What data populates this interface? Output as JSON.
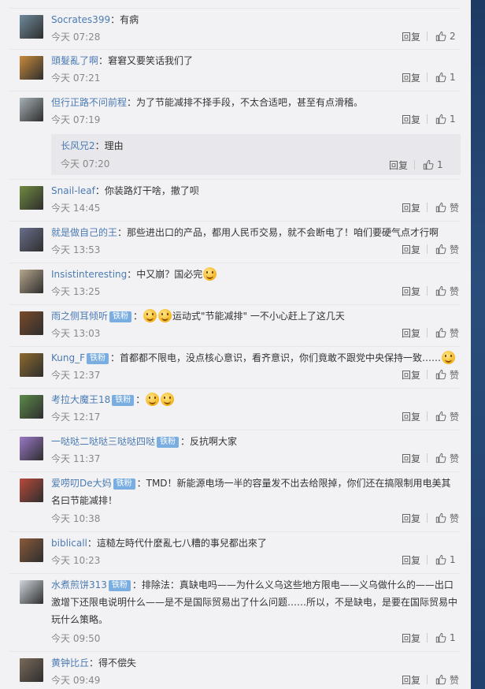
{
  "comments": [
    {
      "user": "Socrates399",
      "badge": "",
      "text": "：有病",
      "time": "今天 07:28",
      "reply": "回复",
      "likes": "2",
      "avatar": "#6e8a9b"
    },
    {
      "user": "頭髮亂了啊",
      "badge": "",
      "text": "：窘窘又要笑话我们了",
      "time": "今天 07:21",
      "reply": "回复",
      "likes": "1",
      "avatar": "#c98a3a"
    },
    {
      "user": "但行正路不问前程",
      "badge": "",
      "text": "：为了节能减排不择手段，不太合适吧，甚至有点滑稽。",
      "time": "今天 07:19",
      "reply": "回复",
      "likes": "1",
      "avatar": "#a7b1b6",
      "sub": {
        "user": "长风兄2",
        "text": "：理由",
        "time": "今天 07:20",
        "reply": "回复",
        "likes": "1"
      }
    },
    {
      "user": "Snail-leaf",
      "badge": "",
      "text": "：你装路灯干啥，撤了呗",
      "time": "今天 14:45",
      "reply": "回复",
      "likes": "赞",
      "avatar": "#6f8a3e"
    },
    {
      "user": "就是做自己的王",
      "badge": "",
      "text": "：那些进出口的产品，都用人民币交易，就不会断电了！咱们要硬气点才行啊",
      "time": "今天 13:53",
      "reply": "回复",
      "likes": "赞",
      "avatar": "#6a6f8c"
    },
    {
      "user": "Insistinteresting",
      "badge": "",
      "text": "：中又崩？国必完",
      "emoji": 1,
      "time": "今天 13:25",
      "reply": "回复",
      "likes": "赞",
      "avatar": "#b7a68c"
    },
    {
      "user": "雨之侧耳倾听",
      "badge": "铁粉",
      "text": "：运动式\"节能减排\"     一不小心赶上了这几天",
      "emojiBefore": 2,
      "time": "今天 13:03",
      "reply": "回复",
      "likes": "赞",
      "avatar": "#7a4a2a"
    },
    {
      "user": "Kung_F",
      "badge": "铁粉",
      "text": "：首都都不限电，没点核心意识，看齐意识，你们竟敢不跟党中央保持一致……",
      "emoji": 1,
      "time": "今天 12:37",
      "reply": "回复",
      "likes": "赞",
      "avatar": "#8e6a2e"
    },
    {
      "user": "考拉大魔王18",
      "badge": "铁粉",
      "text": "：",
      "emoji": 2,
      "time": "今天 12:17",
      "reply": "回复",
      "likes": "赞",
      "avatar": "#5b8a4a"
    },
    {
      "user": "一哒哒二哒哒三哒哒四哒",
      "badge": "铁粉",
      "text": "：反抗啊大家",
      "time": "今天 11:37",
      "reply": "回复",
      "likes": "赞",
      "avatar": "#9a78c8"
    },
    {
      "user": "爱唠叨De大妈",
      "badge": "铁粉",
      "text": "：TMD！新能源电场一半的容量发不出去给限掉，你们还在搞限制用电美其名曰节能减排！",
      "time": "今天 10:38",
      "reply": "回复",
      "likes": "赞",
      "avatar": "#b84a3a"
    },
    {
      "user": "biblicall",
      "badge": "",
      "text": "：這糙左時代什麼亂七八糟的事兒都出來了",
      "time": "今天 10:23",
      "reply": "回复",
      "likes": "1",
      "avatar": "#8a5a3a"
    },
    {
      "user": "水煮煎饼313",
      "badge": "铁粉",
      "text": "：排除法：真缺电吗——为什么义乌这些地方限电——义乌做什么的——出口激增下还限电说明什么——是不是国际贸易出了什么问题……所以，不是缺电，是要在国际贸易中玩什么策略。",
      "time": "今天 09:50",
      "reply": "回复",
      "likes": "1",
      "avatar": "#cfd6dc"
    },
    {
      "user": "黄钟比丘",
      "badge": "",
      "text": "：得不偿失",
      "time": "今天 09:49",
      "reply": "回复",
      "likes": "赞",
      "avatar": "#7a6a5a"
    }
  ]
}
